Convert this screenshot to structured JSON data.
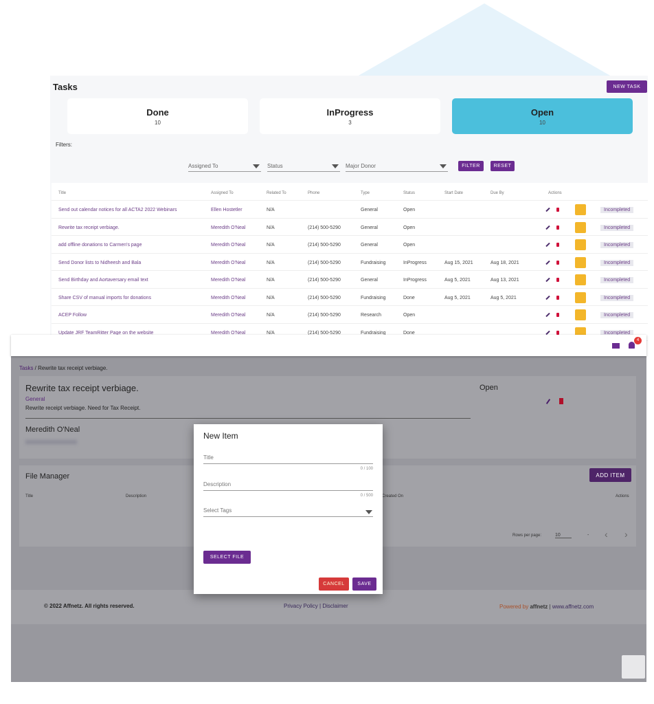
{
  "tasks": {
    "title": "Tasks",
    "new_task": "NEW TASK",
    "cards": [
      {
        "label": "Done",
        "count": "10"
      },
      {
        "label": "InProgress",
        "count": "3"
      },
      {
        "label": "Open",
        "count": "10"
      }
    ],
    "filters_label": "Filters:",
    "filters": [
      "Assigned To",
      "Status",
      "Major Donor"
    ],
    "filter_btn": "FILTER",
    "reset_btn": "RESET",
    "columns": [
      "Title",
      "Assigned To",
      "Related To",
      "Phone",
      "Type",
      "Status",
      "Start Date",
      "Due By",
      "Actions"
    ],
    "rows": [
      [
        "Send out calendar notices for all ACTA2 2022 Webinars",
        "Ellen Hostetler",
        "N/A",
        "",
        "General",
        "Open",
        "",
        "",
        "Incompleted"
      ],
      [
        "Rewrite tax receipt verbiage.",
        "Meredith O'Neal",
        "N/A",
        "(214) 500-5290",
        "General",
        "Open",
        "",
        "",
        "Incompleted"
      ],
      [
        "add offline donations to Carmen's page",
        "Meredith O'Neal",
        "N/A",
        "(214) 500-5290",
        "General",
        "Open",
        "",
        "",
        "Incompleted"
      ],
      [
        "Send Donor lists to Nidheesh and Bala",
        "Meredith O'Neal",
        "N/A",
        "(214) 500-5290",
        "Fundraising",
        "InProgress",
        "Aug 15, 2021",
        "Aug 18, 2021",
        "Incompleted"
      ],
      [
        "Send Birthday and Aortaversary email text",
        "Meredith O'Neal",
        "N/A",
        "(214) 500-5290",
        "General",
        "InProgress",
        "Aug 5, 2021",
        "Aug 13, 2021",
        "Incompleted"
      ],
      [
        "Share CSV of manual imports for donations",
        "Meredith O'Neal",
        "N/A",
        "(214) 500-5290",
        "Fundraising",
        "Done",
        "Aug 5, 2021",
        "Aug 5, 2021",
        "Incompleted"
      ],
      [
        "ACEP Follow",
        "Meredith O'Neal",
        "N/A",
        "(214) 500-5290",
        "Research",
        "Open",
        "",
        "",
        "Incompleted"
      ],
      [
        "Update JRF TeamRitter Page on the website",
        "Meredith O'Neal",
        "N/A",
        "(214) 500-5290",
        "Fundraising",
        "Done",
        "",
        "",
        "Incompleted"
      ]
    ]
  },
  "detail": {
    "notif_count": "4",
    "breadcrumb_root": "Tasks",
    "breadcrumb_current": " / Rewrite tax receipt verbiage.",
    "title": "Rewrite tax receipt verbiage.",
    "type": "General",
    "description": "Rewrite receipt verbiage. Need for Tax Receipt.",
    "status": "Open",
    "assignee": "Meredith O'Neal",
    "file_manager": "File Manager",
    "add_item": "ADD ITEM",
    "fm_columns": [
      "Title",
      "Description",
      "Created On",
      "Actions"
    ],
    "rows_per_page_label": "Rows per page:",
    "rows_per_page": "10",
    "range": "-"
  },
  "modal": {
    "title": "New Item",
    "title_ph": "Title",
    "title_count": "0 / 100",
    "desc_ph": "Description",
    "desc_count": "0 / 500",
    "tags_ph": "Select Tags",
    "select_file": "SELECT FILE",
    "cancel": "CANCEL",
    "save": "SAVE"
  },
  "footer": {
    "copyright": "© 2022 Affnetz. All rights reserved.",
    "privacy": "Privacy Policy",
    "disclaimer": "Disclaimer",
    "powered": "Powered by",
    "brand": "affnetz",
    "site": "www.affnetz.com"
  },
  "colors": {
    "brand": "#6b2c91",
    "open_card": "#4bbfdc",
    "cancel": "#d63a3a",
    "action_yellow": "#f3b62a"
  }
}
